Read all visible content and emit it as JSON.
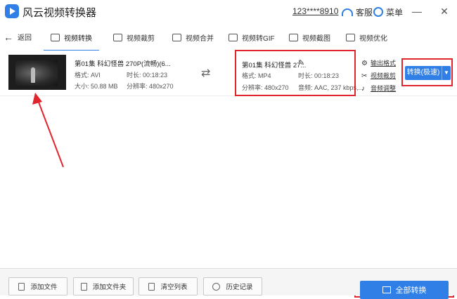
{
  "app": {
    "title": "风云视频转换器",
    "account": "123****8910",
    "support": "客服",
    "menu": "菜单"
  },
  "window": {
    "minimize": "—",
    "close": "✕"
  },
  "toolbar": {
    "back": "返回",
    "tabs": [
      {
        "label": "视频转换",
        "active": true
      },
      {
        "label": "视频裁剪"
      },
      {
        "label": "视频合并"
      },
      {
        "label": "视频转GIF"
      },
      {
        "label": "视频截图"
      },
      {
        "label": "视频优化"
      }
    ]
  },
  "file": {
    "source": {
      "name": "第01集 科幻怪兽 270P(流畅)(6...",
      "format": "格式: AVI",
      "duration": "时长: 00:18:23",
      "size": "大小: 50.88 MB",
      "resolution": "分辨率: 480x270"
    },
    "output": {
      "name": "第01集 科幻怪兽 27...",
      "format": "格式: MP4",
      "duration": "时长: 00:18:23",
      "resolution": "分辨率: 480x270",
      "audio": "音频: AAC, 237 kbps,..."
    },
    "options": {
      "output_format": "输出格式",
      "video_crop": "视频裁剪",
      "audio_adjust": "音频调整"
    },
    "convert_button": "转换(极速)"
  },
  "bottom": {
    "add_file": "添加文件",
    "add_folder": "添加文件夹",
    "clear_list": "清空列表",
    "history": "历史记录",
    "convert_all": "全部转换"
  },
  "colors": {
    "accent": "#2f7fe6",
    "highlight": "#e1252d"
  }
}
